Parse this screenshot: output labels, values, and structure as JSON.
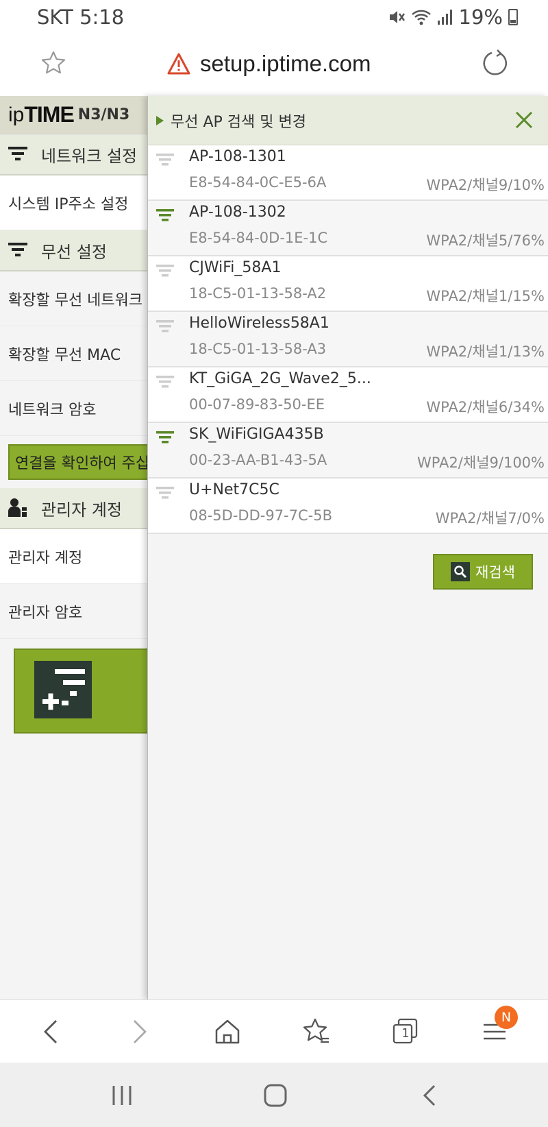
{
  "status_bar": {
    "carrier_time": "SKT 5:18",
    "battery": "19%"
  },
  "address_bar": {
    "url": "setup.iptime.com"
  },
  "sidebar": {
    "logo_ip": "ip",
    "logo_time": "TIME",
    "logo_model": "N3/N3",
    "sections": [
      {
        "title": "네트워크 설정",
        "items": [
          "시스템 IP주소 설정"
        ]
      },
      {
        "title": "무선 설정",
        "items": [
          "확장할 무선 네트워크",
          "확장할 무선 MAC",
          "네트워크 암호"
        ]
      },
      {
        "title": "관리자 계정",
        "items": [
          "관리자 계정",
          "관리자 암호"
        ]
      }
    ],
    "confirm_label": "연결을 확인하여 주십"
  },
  "panel": {
    "title": "무선 AP 검색 및 변경",
    "rescan_label": "재검색",
    "colors": {
      "accent": "#86aa28",
      "signal_strong": "#5a8a2a",
      "signal_weak": "#cccccc"
    },
    "ap_list": [
      {
        "ssid": "AP-108-1301",
        "mac": "E8-54-84-0C-E5-6A",
        "info": "WPA2/채널9/10%",
        "signal": 0.1
      },
      {
        "ssid": "AP-108-1302",
        "mac": "E8-54-84-0D-1E-1C",
        "info": "WPA2/채널5/76%",
        "signal": 0.76
      },
      {
        "ssid": "CJWiFi_58A1",
        "mac": "18-C5-01-13-58-A2",
        "info": "WPA2/채널1/15%",
        "signal": 0.15
      },
      {
        "ssid": "HelloWireless58A1",
        "mac": "18-C5-01-13-58-A3",
        "info": "WPA2/채널1/13%",
        "signal": 0.13
      },
      {
        "ssid": "KT_GiGA_2G_Wave2_5...",
        "mac": "00-07-89-83-50-EE",
        "info": "WPA2/채널6/34%",
        "signal": 0.34
      },
      {
        "ssid": "SK_WiFiGIGA435B",
        "mac": "00-23-AA-B1-43-5A",
        "info": "WPA2/채널9/100%",
        "signal": 1.0
      },
      {
        "ssid": "U+Net7C5C",
        "mac": "08-5D-DD-97-7C-5B",
        "info": "WPA2/채널7/0%",
        "signal": 0.0
      }
    ]
  },
  "toolbar": {
    "tabs_count": "1",
    "notification_badge": "N"
  }
}
